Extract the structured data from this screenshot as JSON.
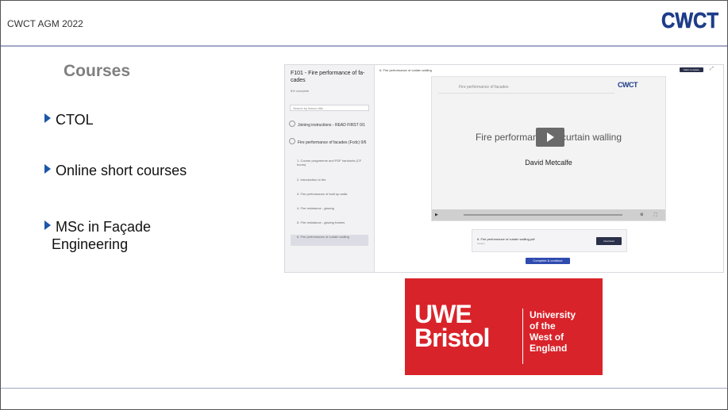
{
  "header": {
    "title": "CWCT AGM 2022",
    "logo_text": "CWCT"
  },
  "slide": {
    "heading": "Courses",
    "bullets": [
      "CTOL",
      "Online short courses",
      "MSc in Façade",
      "Engineering"
    ]
  },
  "course_screenshot": {
    "sidebar_title": "F101 - Fire performance of fa-cades",
    "sidebar_complete": "8% complete",
    "sidebar_search": "Search by lesson title",
    "sections": [
      {
        "label": "Joining instructions - READ FIRST",
        "count": "0/1"
      },
      {
        "label": "Fire performance of facades (Fcdc)",
        "count": "0/6"
      }
    ],
    "lessons": [
      "1. Course programme and PDF handouts (CF hours)",
      "2. Introduction to fire",
      "3. Fire performance of built up walls",
      "4. Fire resistance - glazing",
      "5. Fire resistance - glazing frames",
      "6. Fire performance of curtain walling"
    ],
    "crumb": "6. Fire performance of curtain walling",
    "header_button": "Mark complete",
    "video": {
      "top_text": "Fire performance of facades",
      "logo": "CWCT",
      "title": "Fire performance of curtain walling",
      "author": "David Metcalfe"
    },
    "card": {
      "title": "6. Fire performance of curtain walling.pdf",
      "sub": "Lesson",
      "button": "Download"
    },
    "complete_button": "Complete & continue"
  },
  "uwe_logo": {
    "line1": "UWE",
    "line2": "Bristol",
    "small1": "University",
    "small2": "of the",
    "small3": "West of",
    "small4": "England"
  }
}
